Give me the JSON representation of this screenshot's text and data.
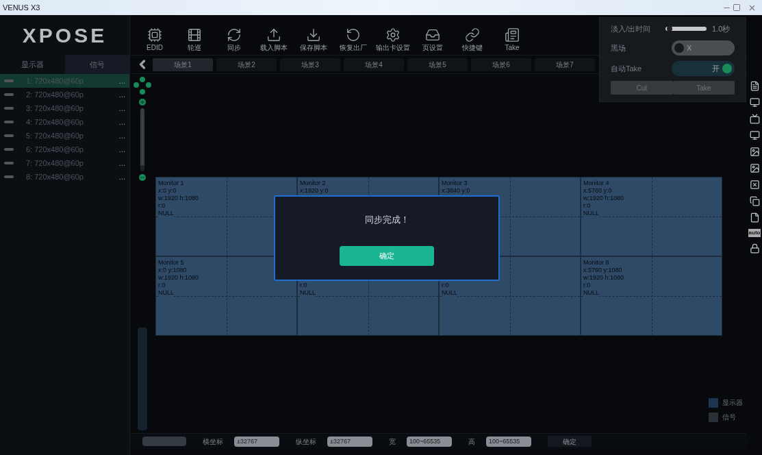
{
  "window": {
    "title": "VENUS X3"
  },
  "logo": {
    "text": "XPOSE"
  },
  "side_tabs": [
    {
      "label": "显示器",
      "selected": false
    },
    {
      "label": "信号",
      "selected": true
    }
  ],
  "signals": [
    {
      "name": "1: 720x480@60p",
      "more": "...",
      "selected": true
    },
    {
      "name": "2: 720x480@60p",
      "more": "...",
      "selected": false
    },
    {
      "name": "3: 720x480@60p",
      "more": "...",
      "selected": false
    },
    {
      "name": "4: 720x480@60p",
      "more": "...",
      "selected": false
    },
    {
      "name": "5: 720x480@60p",
      "more": "...",
      "selected": false
    },
    {
      "name": "6: 720x480@60p",
      "more": "...",
      "selected": false
    },
    {
      "name": "7: 720x480@60p",
      "more": "...",
      "selected": false
    },
    {
      "name": "8: 720x480@60p",
      "more": "...",
      "selected": false
    }
  ],
  "toolbar": [
    {
      "kind": "edid",
      "label": "EDID"
    },
    {
      "kind": "tour",
      "label": "轮巡"
    },
    {
      "kind": "sync",
      "label": "同步"
    },
    {
      "kind": "load",
      "label": "载入脚本"
    },
    {
      "kind": "save",
      "label": "保存脚本"
    },
    {
      "kind": "reset",
      "label": "恢复出厂"
    },
    {
      "kind": "card",
      "label": "输出卡设置"
    },
    {
      "kind": "page",
      "label": "页设置"
    },
    {
      "kind": "link",
      "label": "快捷键"
    },
    {
      "kind": "take",
      "label": "Take"
    }
  ],
  "scenes": [
    {
      "label": "场景1",
      "selected": true
    },
    {
      "label": "场景2",
      "selected": false
    },
    {
      "label": "场景3",
      "selected": false
    },
    {
      "label": "场景4",
      "selected": false
    },
    {
      "label": "场景5",
      "selected": false
    },
    {
      "label": "场景6",
      "selected": false
    },
    {
      "label": "场景7",
      "selected": false
    }
  ],
  "transition_panel": {
    "fade_label": "淡入/出时间",
    "fade": {
      "level": 0.03
    },
    "fade_reading": "1.0秒",
    "black_label": "黑场",
    "black": {
      "on": false,
      "text": "X"
    },
    "auto_label": "自动Take",
    "auto": {
      "on": true,
      "text": "开"
    },
    "buttons": [
      "Cut",
      "Take"
    ]
  },
  "zoom_slider": {
    "level": 0.1
  },
  "monitors": [
    {
      "covered": false,
      "lines": [
        "Monitor 1",
        "x:0  y:0",
        "w:1920  h:1080",
        "r:0",
        "NULL"
      ]
    },
    {
      "covered": false,
      "lines": [
        "Monitor 2",
        "x:1920  y:0"
      ]
    },
    {
      "covered": false,
      "lines": [
        "Monitor 3",
        "x:3840  y:0"
      ]
    },
    {
      "covered": false,
      "lines": [
        "Monitor 4",
        "x:5760  y:0",
        "w:1920  h:1080",
        "r:0",
        "NULL"
      ]
    },
    {
      "covered": false,
      "lines": [
        "Monitor 5",
        "x:0  y:1080",
        "w:1920  h:1080",
        "r:0",
        "NULL"
      ]
    },
    {
      "covered": true,
      "lines": [
        "r:0",
        "NULL"
      ]
    },
    {
      "covered": true,
      "lines": [
        "r:0",
        "NULL"
      ]
    },
    {
      "covered": false,
      "lines": [
        "Monitor 8",
        "x:5760  y:1080",
        "w:1920  h:1080",
        "r:0",
        "NULL"
      ]
    }
  ],
  "dialog": {
    "message": "同步完成！",
    "button": "确定"
  },
  "legend": [
    {
      "label": "显示器",
      "color": "#1d3550"
    },
    {
      "label": "信号",
      "color": "#2a3038"
    }
  ],
  "right_tools": [
    {
      "kind": "doc"
    },
    {
      "kind": "screen"
    },
    {
      "kind": "monitor"
    },
    {
      "kind": "screen"
    },
    {
      "kind": "image"
    },
    {
      "kind": "image"
    },
    {
      "kind": "close"
    },
    {
      "kind": "copy"
    },
    {
      "kind": "file"
    },
    {
      "kind": "auto",
      "text": "auto"
    },
    {
      "kind": "lock"
    }
  ],
  "bottom_bar": {
    "fields": [
      {
        "label": "横坐标",
        "placeholder": "±32767"
      },
      {
        "label": "纵坐标",
        "placeholder": "±32767"
      },
      {
        "label": "宽",
        "placeholder": "100~65535"
      },
      {
        "label": "高",
        "placeholder": "100~65535"
      }
    ],
    "confirm": "确定"
  }
}
